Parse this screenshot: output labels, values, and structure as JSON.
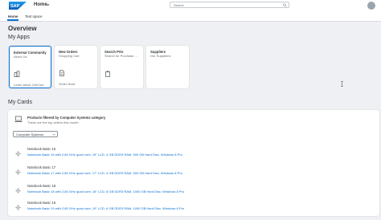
{
  "shell": {
    "logo": "SAP",
    "title": "Home",
    "search_placeholder": "Search"
  },
  "tabs": [
    {
      "label": "Home",
      "active": true
    },
    {
      "label": "Test space",
      "active": false
    }
  ],
  "overview": {
    "title": "Overview",
    "apps_title": "My Apps",
    "cards_title": "My Cards"
  },
  "apps": [
    {
      "title": "External Community",
      "subtitle": "About Us",
      "icon": "building-icon",
      "footer": "Learn about JobCore",
      "selected": true
    },
    {
      "title": "New Orders",
      "subtitle": "Shopping Cart",
      "icon": "document-icon",
      "footer": "Order Now!",
      "selected": false
    },
    {
      "title": "Search POs",
      "subtitle": "Search for Purchase ...",
      "icon": "clipboard-icon",
      "footer": "",
      "selected": false
    },
    {
      "title": "Suppliers",
      "subtitle": "Our Suppliers!",
      "icon": "",
      "footer": "",
      "selected": false
    }
  ],
  "card": {
    "title": "Products filtered by Computer Systems category",
    "subtitle": "These are the top sellers this month",
    "filter_value": "Computer Systems",
    "items": [
      {
        "title": "Notebook Basic 15",
        "description": "Notebook Basic 15 with 2,80 GHz quad core, 15\" LCD, 4 GB DDR3 RAM, 500 GB Hard Disc, Windows 8 Pro"
      },
      {
        "title": "Notebook Basic 17",
        "description": "Notebook Basic 17 with 2,80 GHz quad core, 17\" LCD, 4 GB DDR3 RAM, 500 GB Hard Disc, Windows 8 Pro"
      },
      {
        "title": "Notebook Basic 18",
        "description": "Notebook Basic 18 with 2,80 GHz quad core, 18\" LCD, 8 GB DDR3 RAM, 1000 GB Hard Disc, Windows 8 Pro"
      },
      {
        "title": "Notebook Basic 19",
        "description": "Notebook Basic 19 with 2,80 GHz quad core, 19\" LCD, 8 GB DDR3 RAM, 1000 GB Hard Disc, Windows 8 Pro"
      }
    ]
  },
  "colors": {
    "brand": "#0a6ed1",
    "shell_bg": "#ffffff",
    "page_bg": "#eef0f3"
  }
}
